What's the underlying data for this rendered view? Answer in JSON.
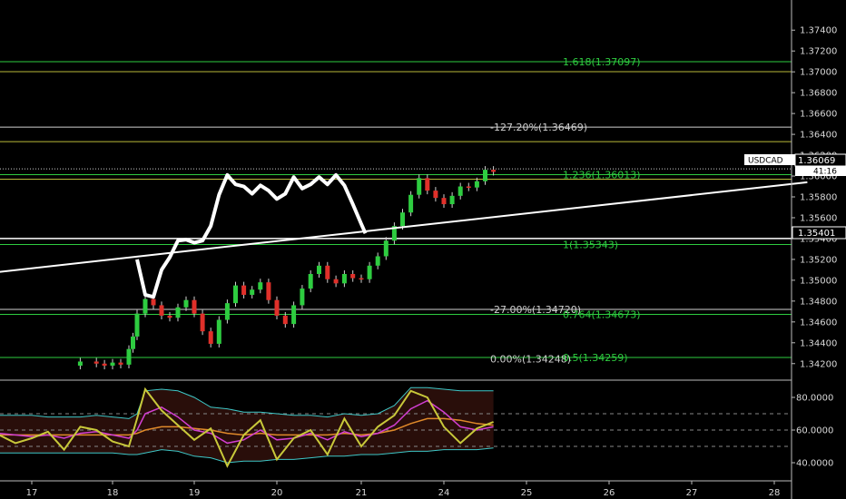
{
  "colors": {
    "background": "#000000",
    "up_candle": "#2ecc40",
    "down_candle": "#e0302a",
    "wick": "#cfcfcf",
    "fib_green": "#2ecc40",
    "fib_gray": "#cfcfcf",
    "horizontal_olive": "#b9b93a",
    "trendline": "#ffffff",
    "osc_yellow": "#c8c83a",
    "osc_magenta": "#d23fd2",
    "osc_orange": "#e08a2a",
    "osc_band": "#3ec7c7",
    "osc_fill": "#4a1a12",
    "axis_text": "#d8d8d8",
    "divider": "#bbbbbb"
  },
  "price_axis": {
    "symbol": "USDCAD",
    "last_price": "1.36069",
    "countdown": "41:16",
    "crosshair_price": "1.35401",
    "ticks": [
      "1.37400",
      "1.37200",
      "1.37000",
      "1.36800",
      "1.36600",
      "1.36400",
      "1.36200",
      "1.36000",
      "1.35800",
      "1.35600",
      "1.35400",
      "1.35200",
      "1.35000",
      "1.34800",
      "1.34600",
      "1.34400",
      "1.34200"
    ]
  },
  "osc_axis": {
    "ticks": [
      "80.0000",
      "60.0000",
      "40.0000"
    ]
  },
  "time_axis": {
    "ticks": [
      "17",
      "18",
      "19",
      "20",
      "21",
      "24",
      "25",
      "26",
      "27",
      "28"
    ]
  },
  "fib_labels": [
    {
      "text": "1.618(1.37097)",
      "level": 1.37097,
      "color": "green"
    },
    {
      "text": "-127.20%(1.36469)",
      "level": 1.36469,
      "color": "gray"
    },
    {
      "text": "1.236(1.36013)",
      "level": 1.36013,
      "color": "green"
    },
    {
      "text": "1(1.35343)",
      "level": 1.35343,
      "color": "green"
    },
    {
      "text": "-27.00%(1.34720)",
      "level": 1.3472,
      "color": "gray"
    },
    {
      "text": "0.764(1.34673)",
      "level": 1.34673,
      "color": "green"
    },
    {
      "text": "0.00%(1.34248)",
      "level": 1.34248,
      "color": "gray"
    },
    {
      "text": "0.5(1.34259)",
      "level": 1.34259,
      "color": "green"
    }
  ],
  "chart_data": {
    "type": "line",
    "symbol": "USDCAD",
    "x_ticks": [
      "17",
      "18",
      "19",
      "20",
      "21",
      "24",
      "25",
      "26",
      "27",
      "28"
    ],
    "y_range": [
      1.3405,
      1.3755
    ],
    "horizontal_levels": [
      {
        "price": 1.37097,
        "kind": "fib"
      },
      {
        "price": 1.37002,
        "kind": "level"
      },
      {
        "price": 1.36469,
        "kind": "fib"
      },
      {
        "price": 1.3633,
        "kind": "level"
      },
      {
        "price": 1.36069,
        "kind": "last_price_dotted"
      },
      {
        "price": 1.36013,
        "kind": "fib"
      },
      {
        "price": 1.3597,
        "kind": "level"
      },
      {
        "price": 1.35401,
        "kind": "crosshair"
      },
      {
        "price": 1.35343,
        "kind": "fib"
      },
      {
        "price": 1.3472,
        "kind": "fib"
      },
      {
        "price": 1.34673,
        "kind": "fib"
      },
      {
        "price": 1.34259,
        "kind": "fib"
      }
    ],
    "trendline": {
      "x": [
        "16.6",
        "28.4"
      ],
      "y": [
        1.3508,
        1.3594
      ]
    },
    "price_series": {
      "x": [
        17.4,
        17.6,
        17.8,
        17.9,
        18.0,
        18.1,
        18.2,
        18.25,
        18.3,
        18.4,
        18.5,
        18.6,
        18.7,
        18.8,
        18.9,
        19.0,
        19.1,
        19.2,
        19.3,
        19.4,
        19.5,
        19.6,
        19.7,
        19.8,
        19.9,
        20.0,
        20.1,
        20.2,
        20.3,
        20.4,
        20.5,
        20.6,
        20.7,
        20.8,
        20.9,
        21.0,
        21.1,
        21.2,
        21.3,
        21.4,
        21.5,
        21.6,
        21.7,
        21.8,
        21.9,
        22.0,
        22.1,
        22.2,
        22.3,
        22.4,
        22.5,
        22.6
      ],
      "y": [
        1.3418,
        1.3422,
        1.342,
        1.3418,
        1.3421,
        1.3419,
        1.3434,
        1.3446,
        1.3468,
        1.3482,
        1.3476,
        1.3466,
        1.3464,
        1.3474,
        1.3481,
        1.3468,
        1.3451,
        1.3439,
        1.3462,
        1.3478,
        1.3495,
        1.3486,
        1.3491,
        1.3498,
        1.3481,
        1.3466,
        1.3458,
        1.3476,
        1.3492,
        1.3506,
        1.3514,
        1.3501,
        1.3497,
        1.3506,
        1.3502,
        1.3501,
        1.3514,
        1.3523,
        1.3538,
        1.3552,
        1.3565,
        1.3582,
        1.3598,
        1.3586,
        1.3579,
        1.3573,
        1.3581,
        1.359,
        1.3589,
        1.3595,
        1.3606,
        1.3604
      ]
    },
    "overlay_series": {
      "x": [
        18.3,
        18.4,
        18.5,
        18.6,
        18.7,
        18.8,
        18.9,
        19.0,
        19.1,
        19.2,
        19.3,
        19.4,
        19.5,
        19.6,
        19.7,
        19.8,
        19.9,
        20.0,
        20.1,
        20.2,
        20.3,
        20.4,
        20.5,
        20.6,
        20.7,
        20.8,
        20.9,
        21.0,
        21.05
      ],
      "y": [
        1.352,
        1.3486,
        1.3484,
        1.351,
        1.3522,
        1.3538,
        1.3539,
        1.3536,
        1.3538,
        1.3552,
        1.3582,
        1.3601,
        1.3592,
        1.359,
        1.3583,
        1.3591,
        1.3586,
        1.3578,
        1.3583,
        1.3599,
        1.3588,
        1.3592,
        1.3599,
        1.3592,
        1.3601,
        1.3591,
        1.3573,
        1.3554,
        1.3545
      ]
    },
    "oscillator": {
      "y_range": [
        30,
        90
      ],
      "y_ticks": [
        80,
        60,
        40
      ],
      "reference_levels": [
        70,
        60,
        50
      ],
      "x": [
        16.6,
        16.8,
        17.0,
        17.2,
        17.4,
        17.6,
        17.8,
        18.0,
        18.2,
        18.3,
        18.4,
        18.6,
        18.8,
        19.0,
        19.2,
        19.4,
        19.6,
        19.8,
        20.0,
        20.2,
        20.4,
        20.6,
        20.8,
        21.0,
        21.2,
        21.4,
        21.6,
        21.8,
        22.0,
        22.2,
        22.4,
        22.6
      ],
      "series": [
        {
          "values": [
            57,
            52,
            55,
            59,
            48,
            62,
            60,
            53,
            50,
            67,
            85,
            72,
            63,
            54,
            61,
            38,
            57,
            66,
            42,
            55,
            60,
            45,
            67,
            50,
            62,
            69,
            84,
            80,
            62,
            52,
            61,
            65
          ]
        },
        {
          "values": [
            58,
            57,
            56,
            57,
            55,
            58,
            59,
            57,
            55,
            60,
            70,
            74,
            68,
            60,
            58,
            52,
            54,
            60,
            54,
            55,
            58,
            54,
            59,
            56,
            58,
            63,
            73,
            78,
            71,
            62,
            60,
            62
          ]
        },
        {
          "values": [
            57,
            57,
            57,
            57,
            57,
            57,
            57,
            57,
            57,
            58,
            60,
            62,
            62,
            61,
            60,
            58,
            57,
            58,
            57,
            57,
            57,
            57,
            58,
            57,
            58,
            60,
            64,
            67,
            67,
            66,
            64,
            63
          ]
        }
      ],
      "bands": {
        "upper": [
          69,
          69,
          69,
          68,
          68,
          68,
          69,
          68,
          67,
          70,
          84,
          85,
          84,
          80,
          74,
          73,
          71,
          71,
          70,
          69,
          69,
          68,
          70,
          69,
          70,
          75,
          86,
          86,
          85,
          84,
          84,
          84
        ],
        "lower": [
          46,
          46,
          46,
          46,
          46,
          46,
          46,
          46,
          45,
          45,
          46,
          48,
          47,
          44,
          43,
          40,
          41,
          41,
          42,
          42,
          43,
          44,
          44,
          45,
          45,
          46,
          47,
          47,
          48,
          48,
          48,
          49
        ]
      }
    }
  }
}
